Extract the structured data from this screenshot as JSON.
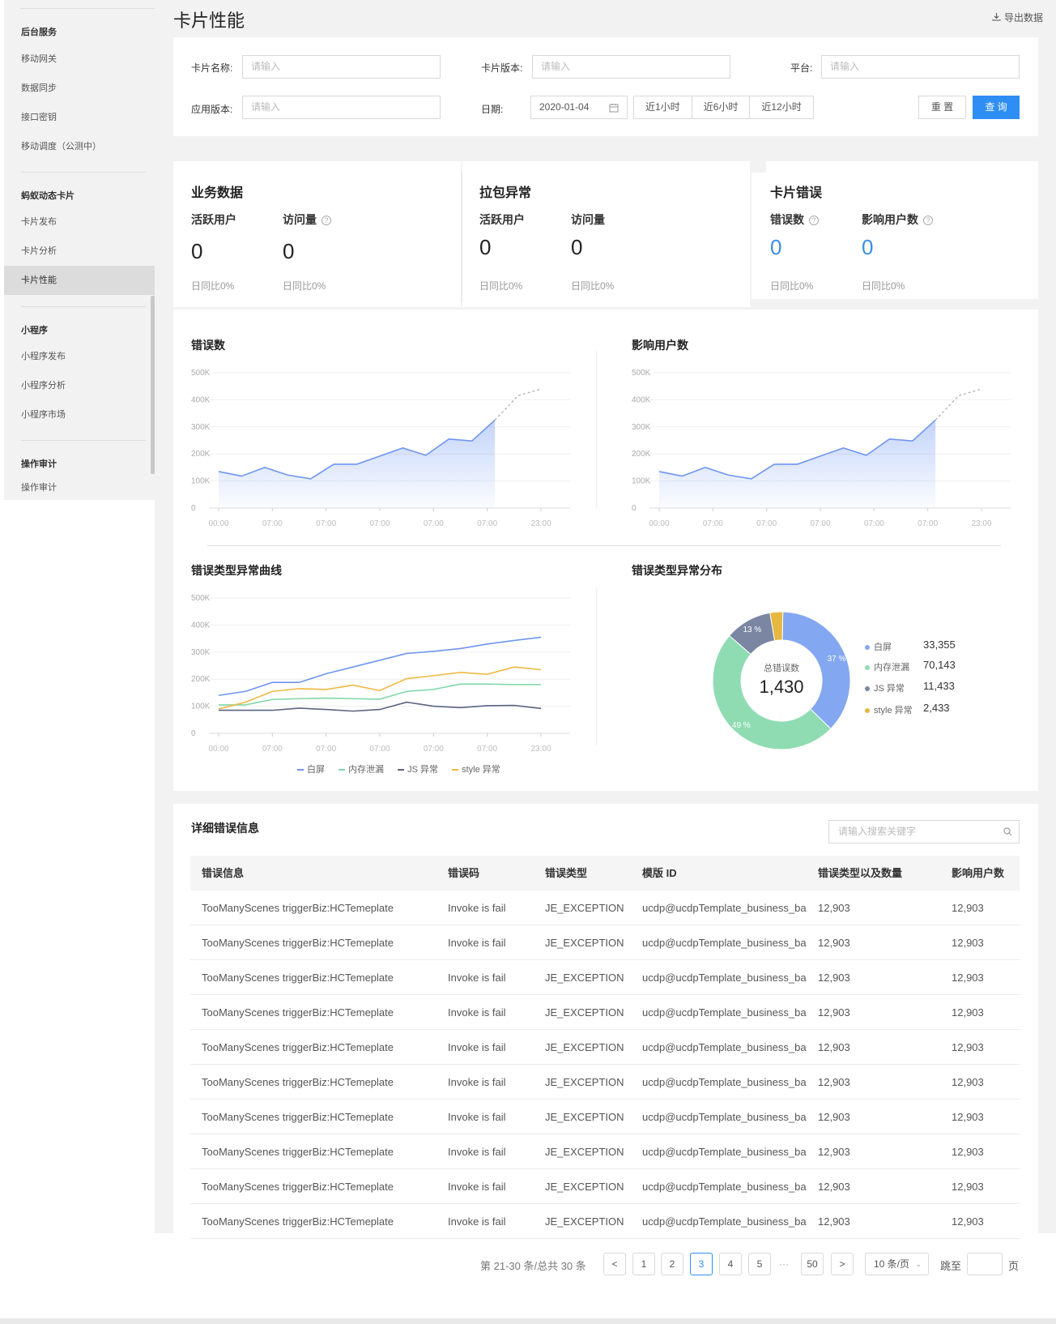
{
  "sidebar": {
    "groups": [
      {
        "title": "后台服务",
        "items": [
          "移动网关",
          "数据同步",
          "接口密钥",
          "移动调度（公测中）"
        ]
      },
      {
        "title": "蚂蚁动态卡片",
        "items": [
          "卡片发布",
          "卡片分析",
          "卡片性能"
        ]
      },
      {
        "title": "小程序",
        "items": [
          "小程序发布",
          "小程序分析",
          "小程序市场"
        ]
      },
      {
        "title": "操作审计",
        "items": [
          "操作审计"
        ]
      }
    ],
    "active": "卡片性能"
  },
  "header": {
    "title": "卡片性能",
    "export_label": "导出数据"
  },
  "filters": {
    "card_name_label": "卡片名称:",
    "card_name_placeholder": "请输入",
    "card_version_label": "卡片版本:",
    "card_version_placeholder": "请输入",
    "platform_label": "平台:",
    "platform_placeholder": "请输入",
    "app_version_label": "应用版本:",
    "app_version_placeholder": "请输入",
    "date_label": "日期:",
    "date_value": "2020-01-04",
    "ranges": [
      "近1小时",
      "近6小时",
      "近12小时"
    ],
    "reset_label": "重 置",
    "query_label": "查 询"
  },
  "stats": {
    "business": {
      "title": "业务数据",
      "a_label": "活跃用户",
      "a_value": "0",
      "a_sub": "日同比0%",
      "b_label": "访问量",
      "b_value": "0",
      "b_sub": "日同比0%"
    },
    "packet": {
      "title": "拉包异常",
      "a_label": "活跃用户",
      "a_value": "0",
      "a_sub": "日同比0%",
      "b_label": "访问量",
      "b_value": "0",
      "b_sub": "日同比0%"
    },
    "card_error": {
      "title": "卡片错误",
      "a_label": "错误数",
      "a_value": "0",
      "a_sub": "日同比0%",
      "b_label": "影响用户数",
      "b_value": "0",
      "b_sub": "日同比0%"
    }
  },
  "chart_data": [
    {
      "type": "area",
      "title": "错误数",
      "x": [
        "00:00",
        "07:00",
        "07:00",
        "07:00",
        "07:00",
        "07:00",
        "23:00"
      ],
      "y_ticks": [
        "0",
        "100K",
        "200K",
        "300K",
        "400K",
        "500K"
      ],
      "ylim": [
        0,
        500000
      ],
      "values": [
        135000,
        118000,
        150000,
        122000,
        108000,
        162000,
        162000,
        192000,
        222000,
        195000,
        255000,
        248000,
        325000
      ],
      "forecast": [
        325000,
        415000,
        440000
      ]
    },
    {
      "type": "area",
      "title": "影响用户数",
      "x": [
        "00:00",
        "07:00",
        "07:00",
        "07:00",
        "07:00",
        "07:00",
        "23:00"
      ],
      "y_ticks": [
        "0",
        "100K",
        "200K",
        "300K",
        "400K",
        "500K"
      ],
      "ylim": [
        0,
        500000
      ],
      "values": [
        135000,
        118000,
        150000,
        122000,
        108000,
        162000,
        162000,
        192000,
        222000,
        195000,
        255000,
        248000,
        325000
      ],
      "forecast": [
        325000,
        415000,
        440000
      ]
    },
    {
      "type": "line",
      "title": "错误类型异常曲线",
      "x": [
        "00:00",
        "07:00",
        "07:00",
        "07:00",
        "07:00",
        "07:00",
        "23:00"
      ],
      "y_ticks": [
        "0",
        "100K",
        "200K",
        "300K",
        "400K",
        "500K"
      ],
      "ylim": [
        0,
        500000
      ],
      "series": [
        {
          "name": "白屏",
          "color": "#6f95f0",
          "values": [
            140000,
            155000,
            188000,
            188000,
            220000,
            245000,
            270000,
            295000,
            303000,
            313000,
            330000,
            343000,
            355000
          ]
        },
        {
          "name": "内存泄漏",
          "color": "#7fd8a6",
          "values": [
            105000,
            105000,
            125000,
            128000,
            130000,
            128000,
            126000,
            155000,
            162000,
            182000,
            182000,
            180000,
            180000
          ]
        },
        {
          "name": "JS 异常",
          "color": "#5b6480",
          "values": [
            85000,
            85000,
            85000,
            93000,
            88000,
            82000,
            88000,
            115000,
            100000,
            95000,
            102000,
            103000,
            92000
          ]
        },
        {
          "name": "style 异常",
          "color": "#f0b842",
          "values": [
            90000,
            115000,
            155000,
            165000,
            162000,
            178000,
            158000,
            202000,
            213000,
            225000,
            218000,
            245000,
            235000
          ]
        }
      ]
    },
    {
      "type": "pie",
      "title": "错误类型异常分布",
      "center_label": "总错误数",
      "center_value": "1,430",
      "slices": [
        {
          "name": "白屏",
          "value": "33,355",
          "percent": 37,
          "pct_label": "37 %",
          "color": "#84a7f2"
        },
        {
          "name": "内存泄漏",
          "value": "70,143",
          "percent": 49,
          "pct_label": "49 %",
          "color": "#8fdcb2"
        },
        {
          "name": "JS 异常",
          "value": "11,433",
          "percent": 11,
          "pct_label": "13 %",
          "color": "#7b86a2"
        },
        {
          "name": "style 异常",
          "value": "2,433",
          "percent": 3,
          "pct_label": "",
          "color": "#e6b840"
        }
      ]
    }
  ],
  "table": {
    "title": "详细错误信息",
    "search_placeholder": "请输入搜索关键字",
    "columns": [
      "错误信息",
      "错误码",
      "错误类型",
      "模版 ID",
      "错误类型以及数量",
      "影响用户数"
    ],
    "rows": [
      [
        "TooManyScenes triggerBiz:HCTemeplate",
        "Invoke is fail",
        "JE_EXCEPTION",
        "ucdp@ucdpTemplate_business_ba",
        "12,903",
        "12,903"
      ],
      [
        "TooManyScenes triggerBiz:HCTemeplate",
        "Invoke is fail",
        "JE_EXCEPTION",
        "ucdp@ucdpTemplate_business_ba",
        "12,903",
        "12,903"
      ],
      [
        "TooManyScenes triggerBiz:HCTemeplate",
        "Invoke is fail",
        "JE_EXCEPTION",
        "ucdp@ucdpTemplate_business_ba",
        "12,903",
        "12,903"
      ],
      [
        "TooManyScenes triggerBiz:HCTemeplate",
        "Invoke is fail",
        "JE_EXCEPTION",
        "ucdp@ucdpTemplate_business_ba",
        "12,903",
        "12,903"
      ],
      [
        "TooManyScenes triggerBiz:HCTemeplate",
        "Invoke is fail",
        "JE_EXCEPTION",
        "ucdp@ucdpTemplate_business_ba",
        "12,903",
        "12,903"
      ],
      [
        "TooManyScenes triggerBiz:HCTemeplate",
        "Invoke is fail",
        "JE_EXCEPTION",
        "ucdp@ucdpTemplate_business_ba",
        "12,903",
        "12,903"
      ],
      [
        "TooManyScenes triggerBiz:HCTemeplate",
        "Invoke is fail",
        "JE_EXCEPTION",
        "ucdp@ucdpTemplate_business_ba",
        "12,903",
        "12,903"
      ],
      [
        "TooManyScenes triggerBiz:HCTemeplate",
        "Invoke is fail",
        "JE_EXCEPTION",
        "ucdp@ucdpTemplate_business_ba",
        "12,903",
        "12,903"
      ],
      [
        "TooManyScenes triggerBiz:HCTemeplate",
        "Invoke is fail",
        "JE_EXCEPTION",
        "ucdp@ucdpTemplate_business_ba",
        "12,903",
        "12,903"
      ],
      [
        "TooManyScenes triggerBiz:HCTemeplate",
        "Invoke is fail",
        "JE_EXCEPTION",
        "ucdp@ucdpTemplate_business_ba",
        "12,903",
        "12,903"
      ]
    ]
  },
  "pagination": {
    "total_text": "第 21-30 条/总共 30 条",
    "prev": "<",
    "next": ">",
    "pages": [
      "1",
      "2",
      "3",
      "4",
      "5"
    ],
    "ellipsis": "···",
    "last": "50",
    "current": "3",
    "page_size": "10 条/页",
    "jump_label": "跳至",
    "jump_suffix": "页"
  },
  "icons": {
    "export": "download-icon",
    "calendar": "calendar-icon",
    "search": "search-icon",
    "help": "help-icon"
  }
}
